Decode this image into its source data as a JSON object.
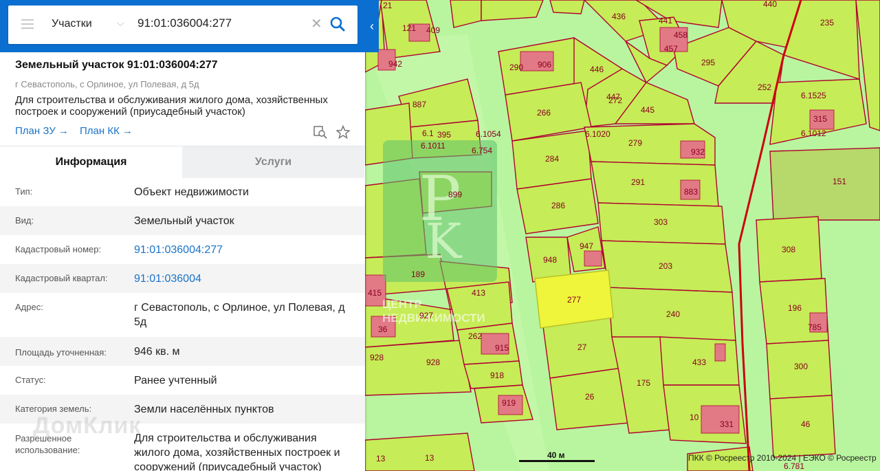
{
  "search": {
    "category": "Участки",
    "query": "91:01:036004:277"
  },
  "object": {
    "title": "Земельный участок 91:01:036004:277",
    "address_short": "г Севастополь, с Орлиное, ул Полевая, д 5д",
    "purpose": "Для строительства и обслуживания жилого дома, хозяйственных построек и сооружений (приусадебный участок)",
    "plan_zu": "План ЗУ →",
    "plan_kk": "План КК →"
  },
  "tabs": {
    "info": "Информация",
    "services": "Услуги"
  },
  "info": [
    {
      "label": "Тип:",
      "value": "Объект недвижимости"
    },
    {
      "label": "Вид:",
      "value": "Земельный участок"
    },
    {
      "label": "Кадастровый номер:",
      "value": "91:01:036004:277"
    },
    {
      "label": "Кадастровый квартал:",
      "value": "91:01:036004"
    },
    {
      "label": "Адрес:",
      "value": "г Севастополь, с Орлиное, ул Полевая, д 5д"
    },
    {
      "label": "Площадь уточненная:",
      "value": "946 кв. м"
    },
    {
      "label": "Статус:",
      "value": "Ранее учтенный"
    },
    {
      "label": "Категория земель:",
      "value": "Земли населённых пунктов"
    },
    {
      "label": "Разрешенное использование:",
      "value": "Для строительства и обслуживания жилого дома, хозяйственных построек и сооружений (приусадебный участок)"
    }
  ],
  "watermark": "ДомКлик",
  "map": {
    "logo_line1": "ЦЕНТР",
    "logo_line2": "НЕДВИЖИМОСТИ",
    "scale_label": "40 м",
    "attribution": "ПКК © Росреестр 2010-2024 | ЕЭКО © Росреестр",
    "parcel_labels": [
      "21",
      "121",
      "409",
      "942",
      "290",
      "906",
      "446",
      "436",
      "441",
      "458",
      "457",
      "440",
      "235",
      "295",
      "252",
      "272",
      "887",
      "447",
      "445",
      "266",
      "6.1525",
      "315",
      "6.1012",
      "6.1",
      "395",
      "6.1011",
      "6.1054",
      "6.754",
      "6.1020",
      "279",
      "932",
      "284",
      "151",
      "291",
      "883",
      "899",
      "286",
      "303",
      "308",
      "948",
      "947",
      "189",
      "203",
      "277",
      "413",
      "240",
      "196",
      "785",
      "415",
      "927",
      "36",
      "262",
      "915",
      "27",
      "433",
      "928",
      "928",
      "918",
      "175",
      "300",
      "919",
      "26",
      "10",
      "331",
      "46",
      "13",
      "13",
      "6.781"
    ]
  },
  "colors": {
    "accent": "#0b6fd1",
    "link": "#1a73c8",
    "parcel": "#c6ec57",
    "selected": "#eef53a",
    "boundary": "#b00030"
  }
}
